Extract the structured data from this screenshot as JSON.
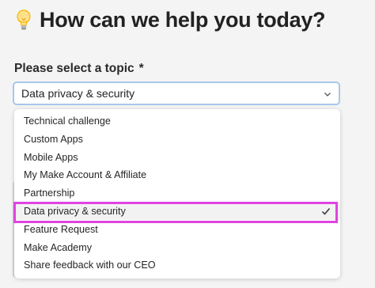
{
  "heading": {
    "title": "How can we help you today?",
    "icon": "lightbulb-icon"
  },
  "topic_field": {
    "label": "Please select a topic",
    "required_marker": "*",
    "selected_value": "Data privacy & security"
  },
  "options": [
    {
      "label": "Technical challenge",
      "selected": false
    },
    {
      "label": "Custom Apps",
      "selected": false
    },
    {
      "label": "Mobile Apps",
      "selected": false
    },
    {
      "label": "My Make Account & Affiliate",
      "selected": false
    },
    {
      "label": "Partnership",
      "selected": false
    },
    {
      "label": "Data privacy & security",
      "selected": true
    },
    {
      "label": "Feature Request",
      "selected": false
    },
    {
      "label": "Make Academy",
      "selected": false
    },
    {
      "label": "Share feedback with our CEO",
      "selected": false
    }
  ],
  "colors": {
    "highlight": "#e044e0",
    "focus_border": "#a9c6ec",
    "background": "#f4f4f4"
  }
}
